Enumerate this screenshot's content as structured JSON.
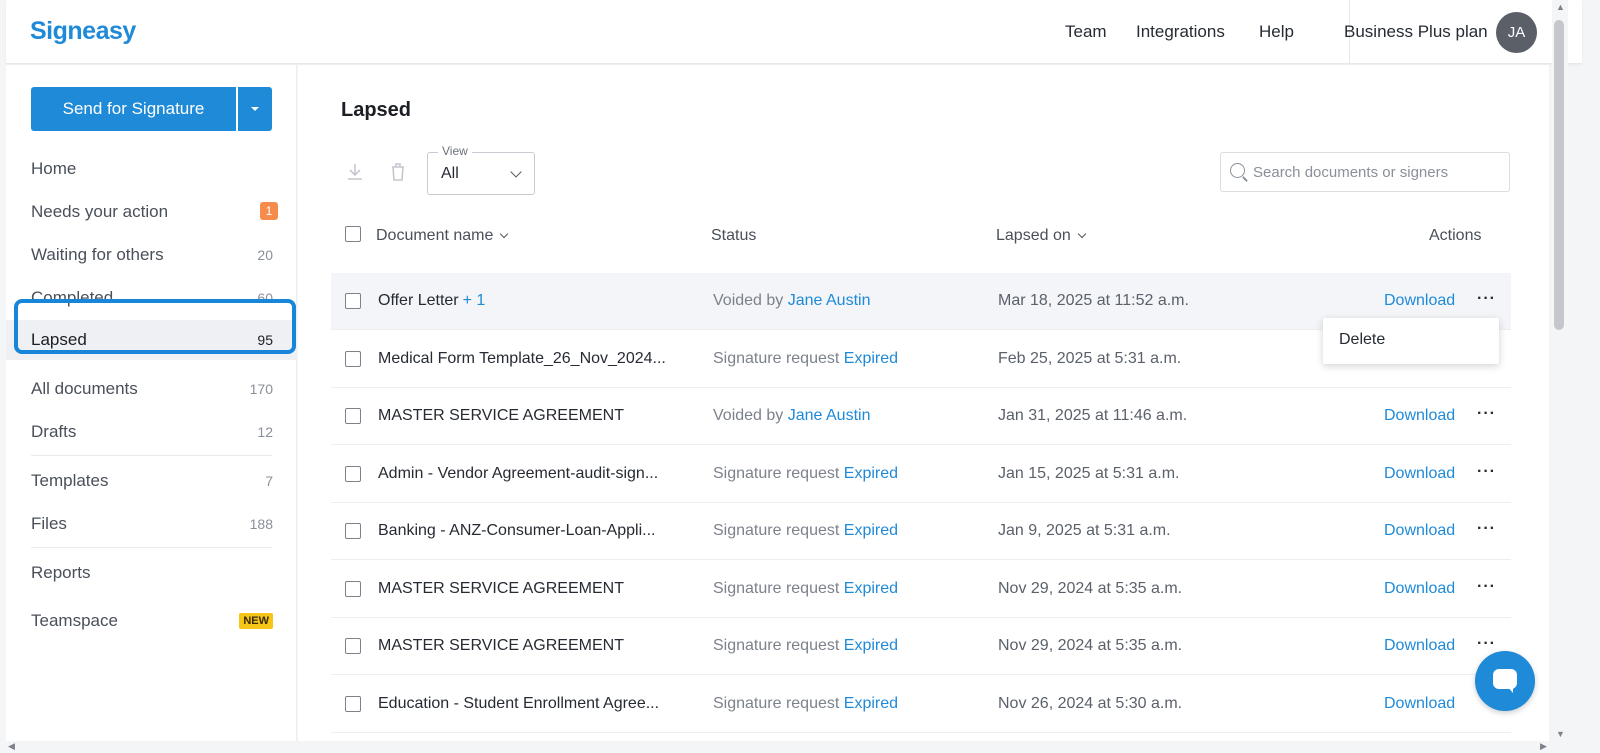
{
  "header": {
    "logo": "Signeasy",
    "nav": [
      "Team",
      "Integrations",
      "Help"
    ],
    "plan": "Business Plus plan",
    "avatar_initials": "JA"
  },
  "sidebar": {
    "send_button": "Send for Signature",
    "items": [
      {
        "label": "Home",
        "count": ""
      },
      {
        "label": "Needs your action",
        "count": "1"
      },
      {
        "label": "Waiting for others",
        "count": "20"
      },
      {
        "label": "Completed",
        "count": "60"
      },
      {
        "label": "Lapsed",
        "count": "95"
      },
      {
        "label": "All documents",
        "count": "170"
      },
      {
        "label": "Drafts",
        "count": "12"
      },
      {
        "label": "Templates",
        "count": "7"
      },
      {
        "label": "Files",
        "count": "188"
      },
      {
        "label": "Reports",
        "count": ""
      },
      {
        "label": "Teamspace",
        "badge": "NEW"
      }
    ]
  },
  "main": {
    "title": "Lapsed",
    "view": {
      "label": "View",
      "value": "All"
    },
    "search_placeholder": "Search documents or signers",
    "columns": {
      "name": "Document name",
      "status": "Status",
      "date": "Lapsed on",
      "actions": "Actions"
    },
    "rows": [
      {
        "name": "Offer Letter",
        "extra": "+ 1",
        "status_prefix": "Voided by",
        "status_link": "Jane Austin",
        "date": "Mar 18, 2025 at 11:52 a.m.",
        "action": "Download"
      },
      {
        "name": "Medical Form Template_26_Nov_2024...",
        "extra": "",
        "status_prefix": "Signature request",
        "status_link": "Expired",
        "date": "Feb 25, 2025 at 5:31 a.m.",
        "action": ""
      },
      {
        "name": "MASTER SERVICE AGREEMENT",
        "extra": "",
        "status_prefix": "Voided by",
        "status_link": "Jane Austin",
        "date": "Jan 31, 2025 at 11:46 a.m.",
        "action": "Download"
      },
      {
        "name": "Admin - Vendor Agreement-audit-sign...",
        "extra": "",
        "status_prefix": "Signature request",
        "status_link": "Expired",
        "date": "Jan 15, 2025 at 5:31 a.m.",
        "action": "Download"
      },
      {
        "name": "Banking - ANZ-Consumer-Loan-Appli...",
        "extra": "",
        "status_prefix": "Signature request",
        "status_link": "Expired",
        "date": "Jan 9, 2025 at 5:31 a.m.",
        "action": "Download"
      },
      {
        "name": "MASTER SERVICE AGREEMENT",
        "extra": "",
        "status_prefix": "Signature request",
        "status_link": "Expired",
        "date": "Nov 29, 2024 at 5:35 a.m.",
        "action": "Download"
      },
      {
        "name": "MASTER SERVICE AGREEMENT",
        "extra": "",
        "status_prefix": "Signature request",
        "status_link": "Expired",
        "date": "Nov 29, 2024 at 5:35 a.m.",
        "action": "Download"
      },
      {
        "name": "Education - Student Enrollment Agree...",
        "extra": "",
        "status_prefix": "Signature request",
        "status_link": "Expired",
        "date": "Nov 26, 2024 at 5:30 a.m.",
        "action": "Download"
      }
    ],
    "context_menu": {
      "item": "Delete"
    }
  },
  "colors": {
    "accent": "#1f8ad8",
    "highlight": "#1786d8",
    "badge_orange": "#f58c4b",
    "badge_new": "#f5c518"
  }
}
